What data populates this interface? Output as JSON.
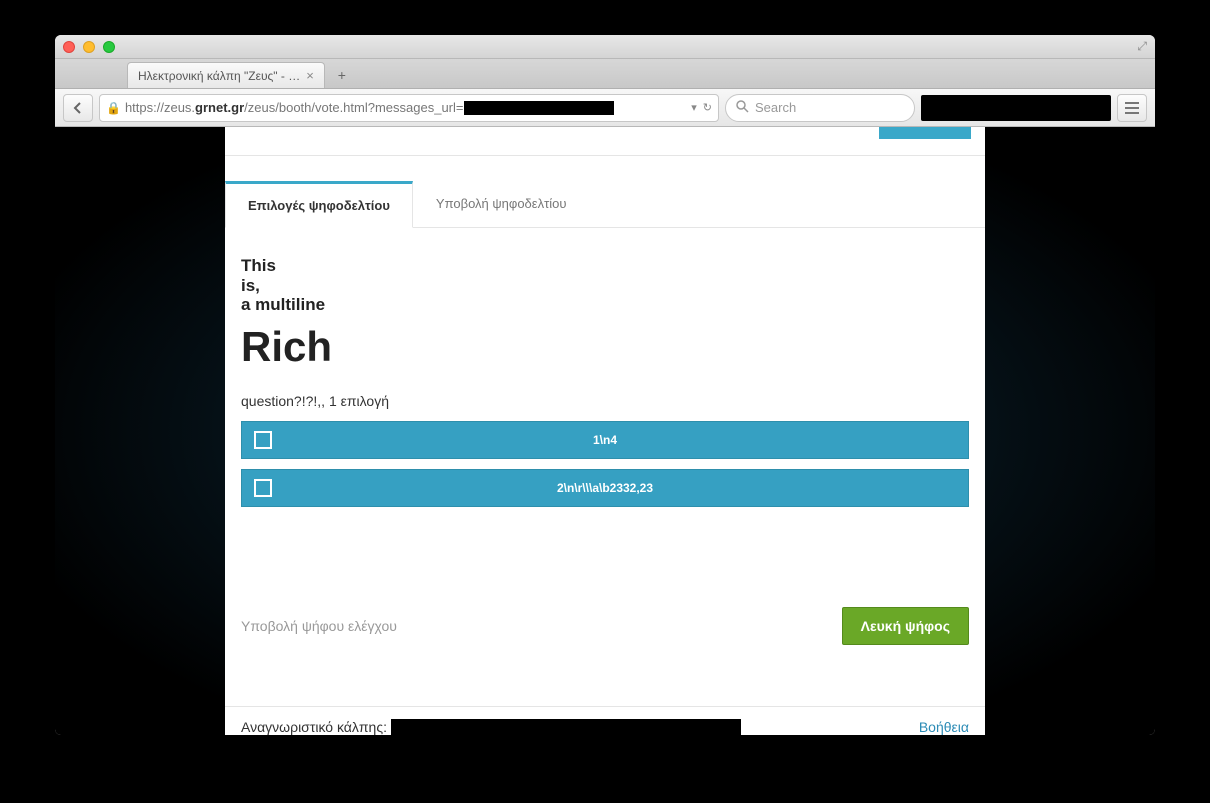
{
  "browser": {
    "tab_title": "Ηλεκτρονική κάλπη \"Ζευς\" - …",
    "url_prefix": "https://zeus.",
    "url_domain": "grnet.gr",
    "url_path": "/zeus/booth/vote.html?messages_url=",
    "search_placeholder": "Search"
  },
  "page": {
    "tabs": {
      "options": "Επιλογές ψηφοδελτίου",
      "submit": "Υποβολή ψηφοδελτίου"
    },
    "question_line1": "This",
    "question_line2": "is,",
    "question_line3": "a multiline",
    "question_rich": "Rich",
    "sub": "question?!?!,, 1 επιλογή",
    "options": [
      {
        "label": "1\\n4"
      },
      {
        "label": "2\\n\\r\\\\\\a\\b2332,23"
      }
    ],
    "audit_label": "Υποβολή ψήφου ελέγχου",
    "blank_label": "Λευκή ψήφος",
    "footer_id_label": "Αναγνωριστικό κάλπης:",
    "help": "Βοήθεια"
  }
}
